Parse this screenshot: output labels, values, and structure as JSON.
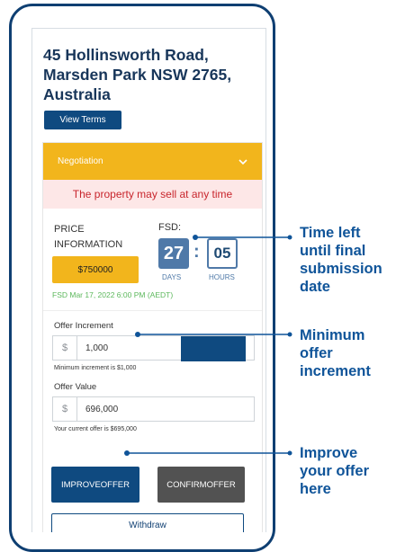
{
  "address": "45 Hollinsworth Road, Marsden Park NSW 2765, Australia",
  "view_terms_label": "View Terms",
  "negotiation": {
    "label": "Negotiation",
    "warning": "The property may sell at any time"
  },
  "price": {
    "heading_line1": "PRICE",
    "heading_line2": "INFORMATION",
    "value": "$750000"
  },
  "fsd": {
    "heading": "FSD:",
    "days": "27",
    "hours": "05",
    "days_label": "DAYS",
    "hours_label": "HOURS",
    "colon": ":",
    "date": "FSD Mar 17, 2022 6:00 PM (AEDT)"
  },
  "offer_increment": {
    "label": "Offer Increment",
    "currency": "$",
    "value": "1,000",
    "hint": "Minimum increment is $1,000"
  },
  "offer_value": {
    "label": "Offer Value",
    "currency": "$",
    "value": "696,000",
    "hint": "Your current offer is $695,000"
  },
  "buttons": {
    "improve_line1": "IMPROVE",
    "improve_line2": "OFFER",
    "confirm_line1": "CONFIRM",
    "confirm_line2": "OFFER",
    "withdraw": "Withdraw"
  },
  "callouts": {
    "time_left": [
      "Time left",
      "until final",
      "submission",
      "date"
    ],
    "min_increment": [
      "Minimum",
      "offer",
      "increment"
    ],
    "improve": [
      "Improve",
      "your offer",
      "here"
    ]
  },
  "colors": {
    "brand_blue": "#0f4a80",
    "accent_yellow": "#f2b51c",
    "warning_red": "#c8262d",
    "success_green": "#5cb85c"
  }
}
